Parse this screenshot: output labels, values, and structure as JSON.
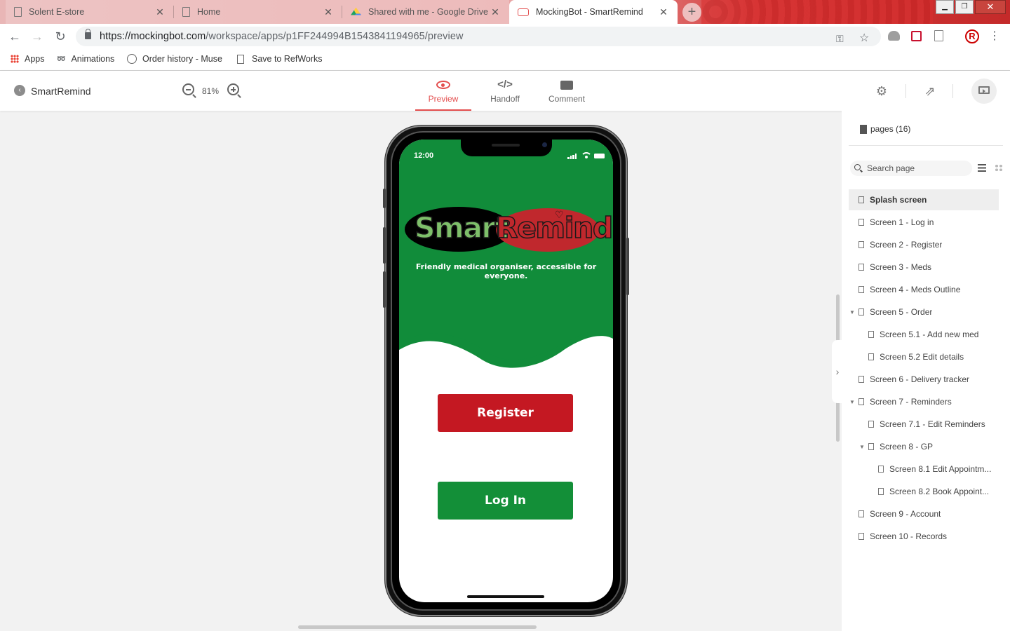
{
  "browser": {
    "tabs": [
      {
        "title": "Solent E-store",
        "icon": "doc-icon"
      },
      {
        "title": "Home",
        "icon": "doc-icon"
      },
      {
        "title": "Shared with me - Google Drive",
        "icon": "google-drive-icon"
      },
      {
        "title": "MockingBot - SmartRemind",
        "icon": "mockingbot-icon",
        "active": true
      }
    ],
    "close_glyph": "✕",
    "new_tab_glyph": "+",
    "url_host": "https://mockingbot.com",
    "url_path": "/workspace/apps/p1FF244994B1543841194965/preview",
    "profile_initial": "R",
    "bookmarks": [
      {
        "label": "Apps",
        "icon": "apps-grid-icon"
      },
      {
        "label": "Animations",
        "icon": "animations-icon"
      },
      {
        "label": "Order history - Muse",
        "icon": "muse-icon"
      },
      {
        "label": "Save to RefWorks",
        "icon": "doc-icon"
      }
    ]
  },
  "toolbar": {
    "project_name": "SmartRemind",
    "zoom": "81%",
    "modes": [
      {
        "label": "Preview",
        "icon": "eye-icon",
        "active": true
      },
      {
        "label": "Handoff",
        "icon": "code-icon"
      },
      {
        "label": "Comment",
        "icon": "comment-icon"
      }
    ]
  },
  "phone": {
    "status_time": "12:00",
    "logo_word_1": "Smart",
    "logo_word_2": "Remind",
    "tagline": "Friendly medical organiser, accessible for everyone.",
    "register_label": "Register",
    "login_label": "Log In",
    "colors": {
      "green": "#118c3a",
      "red": "#c41822",
      "button_green": "#138f38"
    }
  },
  "pages_panel": {
    "header": "pages (16)",
    "search_placeholder": "Search page",
    "pages": [
      {
        "label": "Splash screen",
        "depth": 0,
        "selected": true
      },
      {
        "label": "Screen 1 - Log in",
        "depth": 0
      },
      {
        "label": "Screen 2 - Register",
        "depth": 0
      },
      {
        "label": "Screen 3 - Meds",
        "depth": 0
      },
      {
        "label": "Screen 4 - Meds Outline",
        "depth": 0
      },
      {
        "label": "Screen 5 - Order",
        "depth": 0,
        "expanded": true
      },
      {
        "label": "Screen 5.1 - Add new med",
        "depth": 1
      },
      {
        "label": "Screen 5.2 Edit details",
        "depth": 1
      },
      {
        "label": "Screen 6 - Delivery tracker",
        "depth": 0
      },
      {
        "label": "Screen 7 - Reminders",
        "depth": 0,
        "expanded": true
      },
      {
        "label": "Screen 7.1 - Edit Reminders",
        "depth": 1
      },
      {
        "label": "Screen 8 - GP",
        "depth": 1,
        "expanded": true
      },
      {
        "label": "Screen 8.1 Edit Appointm...",
        "depth": 2
      },
      {
        "label": "Screen 8.2 Book Appoint...",
        "depth": 2
      },
      {
        "label": "Screen 9 - Account",
        "depth": 0
      },
      {
        "label": "Screen 10 - Records",
        "depth": 0
      }
    ]
  }
}
